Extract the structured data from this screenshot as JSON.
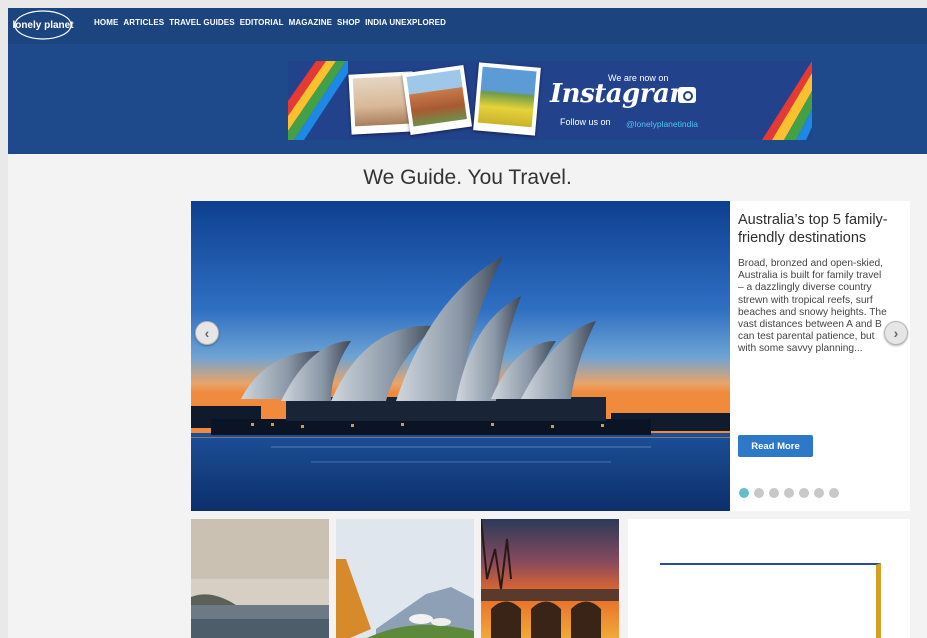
{
  "header": {
    "logo_text": "lonely planet",
    "nav": [
      "HOME",
      "ARTICLES",
      "TRAVEL GUIDES",
      "EDITORIAL",
      "MAGAZINE",
      "SHOP",
      "INDIA UNEXPLORED"
    ]
  },
  "banner": {
    "line1": "We are now on",
    "brand": "Instagram",
    "follow": "Follow us on",
    "handle": "@lonelyplanetindia"
  },
  "tagline": "We Guide. You Travel.",
  "slider": {
    "title": "Australia’s top 5 family-friendly destinations",
    "description": "Broad, bronzed and open-skied, Australia is built for family travel – a dazzlingly diverse country strewn with tropical reefs, surf beaches and snowy heights. The vast distances between A and B can test parental patience, but with some savvy planning...",
    "read_more": "Read More",
    "dot_count": 7,
    "active_dot": 0
  },
  "colors": {
    "header_bg": "#1e4a8c",
    "nav_bg": "#1c4580",
    "button": "#2d79c7",
    "active_dot": "#5fc0c8"
  }
}
